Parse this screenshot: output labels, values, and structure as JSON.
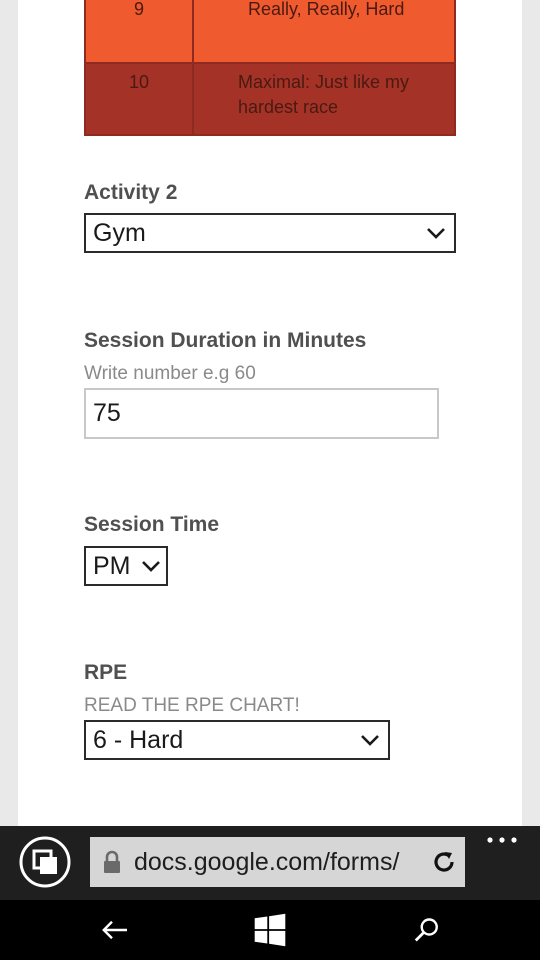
{
  "rpe_chart": {
    "rows": [
      {
        "level": "9",
        "description": "Really, Really, Hard"
      },
      {
        "level": "10",
        "description_line1": "Maximal: Just like my",
        "description_line2": "hardest race"
      }
    ]
  },
  "activity2": {
    "label": "Activity 2",
    "selected": "Gym"
  },
  "duration": {
    "label": "Session Duration in Minutes",
    "help": "Write number e.g 60",
    "value": "75"
  },
  "session_time": {
    "label": "Session Time",
    "selected": "PM"
  },
  "rpe": {
    "label": "RPE",
    "help": "READ THE RPE CHART!",
    "selected": "6 - Hard"
  },
  "browser": {
    "url": "docs.google.com/forms/"
  },
  "icons": [
    "chevron-down-icon",
    "tabs-icon",
    "lock-icon",
    "refresh-icon",
    "more-icon",
    "back-arrow-icon",
    "windows-start-icon",
    "search-icon"
  ],
  "colors": {
    "rpe9": "#ef5a2e",
    "rpe10": "#a43226",
    "browser_bar": "#1f1f1f",
    "nav_bar": "#000000"
  }
}
